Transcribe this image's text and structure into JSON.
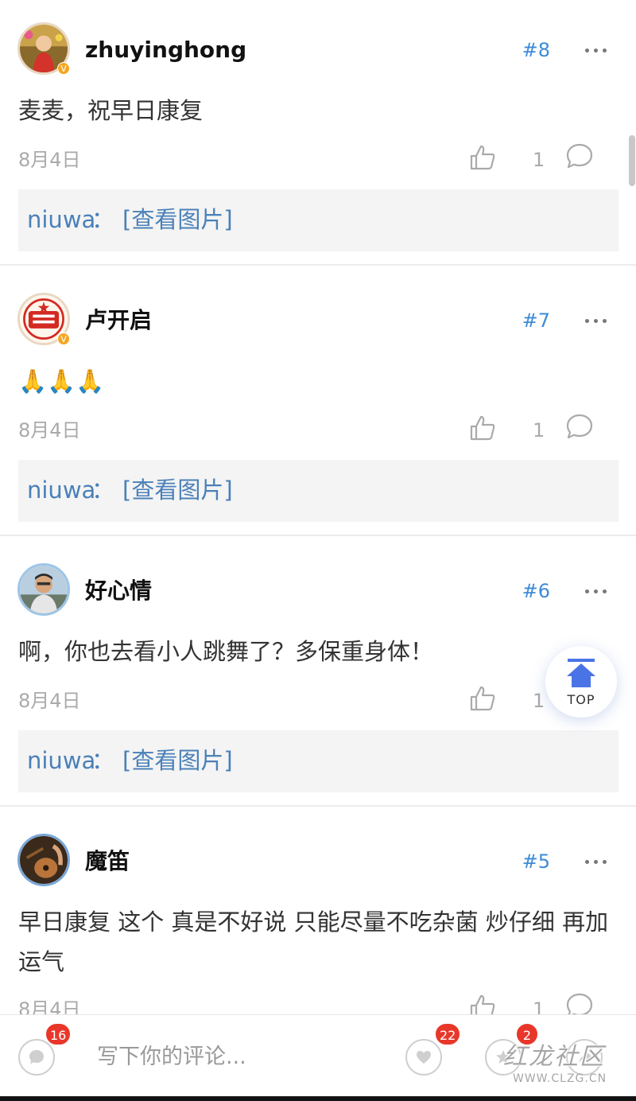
{
  "comments": [
    {
      "username": "zhuyinghong",
      "floor": "#8",
      "content": "麦麦，祝早日康复",
      "date": "8月4日",
      "like_count": "1",
      "avatar_icon": "user-avatar-photo",
      "verified_badge": "V",
      "reply": {
        "user": "niuwa",
        "sep": "：",
        "text": "[查看图片]"
      }
    },
    {
      "username": "卢开启",
      "floor": "#7",
      "content": "🙏🙏🙏",
      "date": "8月4日",
      "like_count": "1",
      "avatar_icon": "user-avatar-emblem",
      "verified_badge": "V",
      "reply": {
        "user": "niuwa",
        "sep": "：",
        "text": "[查看图片]"
      }
    },
    {
      "username": "好心情",
      "floor": "#6",
      "content": "啊，你也去看小人跳舞了？多保重身体！",
      "date": "8月4日",
      "like_count": "1",
      "avatar_icon": "user-avatar-photo",
      "reply": {
        "user": "niuwa",
        "sep": "：",
        "text": "[查看图片]"
      }
    },
    {
      "username": "魔笛",
      "floor": "#5",
      "content": "早日康复 这个 真是不好说 只能尽量不吃杂菌 炒仔细 再加运气",
      "date": "8月4日",
      "like_count": "1",
      "avatar_icon": "user-avatar-photo"
    }
  ],
  "top_button": {
    "label": "TOP",
    "icon": "arrow-up-icon",
    "accent": "#4a74e6"
  },
  "bottom_bar": {
    "comment_badge": "16",
    "input_placeholder": "写下你的评论...",
    "like_badge": "22",
    "share_badge": "2"
  },
  "watermark": {
    "text": "红龙社区",
    "url": "WWW.CLZG.CN"
  },
  "colors": {
    "floor": "#3d8bd6",
    "reply_text": "#4a80b8",
    "badge": "#e8372a"
  }
}
